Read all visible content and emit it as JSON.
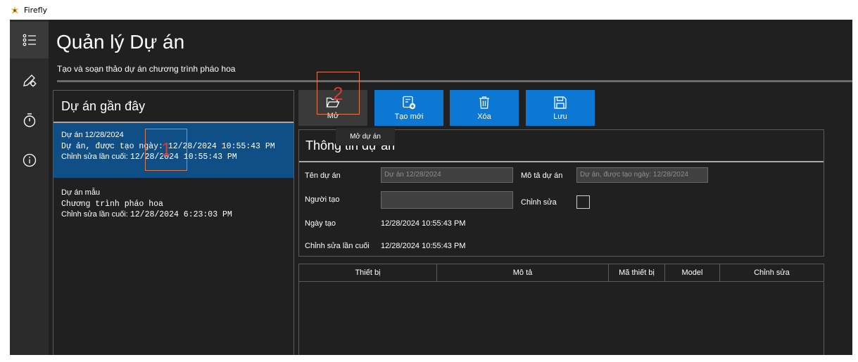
{
  "window": {
    "title": "Firefly"
  },
  "nav": {
    "items": [
      {
        "name": "nav-projects",
        "icon": "list-icon",
        "active": true
      },
      {
        "name": "nav-editor",
        "icon": "pen-gear-icon"
      },
      {
        "name": "nav-timer",
        "icon": "stopwatch-icon"
      },
      {
        "name": "nav-about",
        "icon": "info-icon"
      }
    ]
  },
  "header": {
    "title": "Quản lý Dự án",
    "subtitle": "Tạo và soạn thảo dự án chương trình pháo hoa"
  },
  "recent": {
    "title": "Dự án gần đây",
    "items": [
      {
        "name": "Dự án 12/28/2024",
        "desc": "Dự án, được tạo ngày: 12/28/2024 10:55:43 PM",
        "edit_label": "Chỉnh sửa lần cuối:",
        "edit_time": "12/28/2024 10:55:43 PM",
        "selected": true
      },
      {
        "name": "Dự án mẫu",
        "desc": "Chương trình pháo hoa",
        "edit_label": "Chỉnh sửa lần cuối:",
        "edit_time": "12/28/2024 6:23:03 PM",
        "selected": false
      }
    ]
  },
  "toolbar": {
    "open_label": "Mở",
    "new_label": "Tạo mới",
    "delete_label": "Xóa",
    "save_label": "Lưu",
    "open_tooltip": "Mở dự án"
  },
  "info": {
    "title": "Thông tin dự án",
    "name_label": "Tên dự án",
    "name_value": "Dự án 12/28/2024",
    "desc_label": "Mô tả dự án",
    "desc_value": "Dự án, được tạo ngày: 12/28/2024",
    "creator_label": "Người tạo",
    "creator_value": "",
    "edit_label": "Chỉnh sửa",
    "created_label": "Ngày tạo",
    "created_value": "12/28/2024 10:55:43 PM",
    "modified_label": "Chỉnh sửa lần cuối",
    "modified_value": "12/28/2024 10:55:43 PM"
  },
  "devices": {
    "columns": [
      "Thiết bị",
      "Mô tả",
      "Mã thiết bị",
      "Model",
      "Chỉnh sửa"
    ]
  },
  "annotations": [
    {
      "label": "1"
    },
    {
      "label": "2"
    }
  ],
  "colors": {
    "accent": "#0d78d4",
    "selected": "#0f4f86",
    "background": "#202020",
    "annotation": "#e0352b"
  }
}
